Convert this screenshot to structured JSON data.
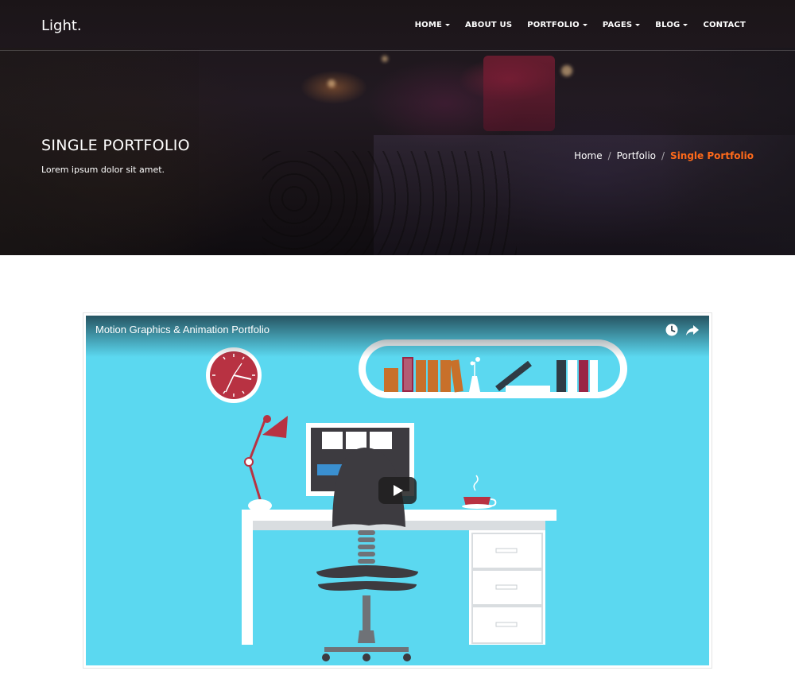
{
  "navbar": {
    "brand": "Light.",
    "items": [
      {
        "label": "HOME",
        "dropdown": true
      },
      {
        "label": "ABOUT US",
        "dropdown": false
      },
      {
        "label": "PORTFOLIO",
        "dropdown": true
      },
      {
        "label": "PAGES",
        "dropdown": true
      },
      {
        "label": "BLOG",
        "dropdown": true
      },
      {
        "label": "CONTACT",
        "dropdown": false
      }
    ]
  },
  "hero": {
    "title": "SINGLE PORTFOLIO",
    "subtitle": "Lorem ipsum dolor sit amet."
  },
  "breadcrumb": {
    "items": [
      "Home",
      "Portfolio"
    ],
    "separator": "/",
    "active": "Single Portfolio"
  },
  "video": {
    "title": "Motion Graphics & Animation Portfolio",
    "icons": [
      "watch-later-icon",
      "share-icon",
      "play-icon"
    ]
  },
  "colors": {
    "accent": "#ff6a1a",
    "video_bg": "#5bd8f0",
    "clock_red": "#b83242",
    "chair_dark": "#3d3b40"
  }
}
